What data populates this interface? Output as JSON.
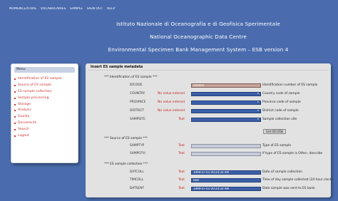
{
  "top_nav": {
    "items": [
      "NOMENCLATURE",
      "VOCABULARIES",
      "SAMPLE",
      "SIGN OUT",
      "HELP"
    ]
  },
  "header": {
    "line1": "Istituto Nazionale di Oceanografia e di Geofisica Sperimentale",
    "line2": "National Oceanographic Data Centre",
    "line3": "Environmental Specimen Bank Management System – ESB version 4"
  },
  "sidebar": {
    "heading": "Menu",
    "items": [
      "Identification of ES sample",
      "Source of ES sample",
      "ES sample collection",
      "Sample processing",
      "Storage",
      "Analysis",
      "Quality",
      "Documents",
      "Search",
      "Logout"
    ]
  },
  "panel": {
    "title": "Insert ES sample metadata",
    "sections": {
      "identification": "*** Identification of ES sample ***",
      "source": "*** Source of ES sample ***",
      "collection": "*** ES sample collection ***"
    },
    "fields": {
      "idcode": {
        "name": "IDCODE",
        "note": "",
        "value": "000005",
        "desc": "Identification number of ES sample"
      },
      "country": {
        "name": "COUNTRY",
        "note": "No value entered",
        "value": "",
        "desc": "Country code of sample"
      },
      "province": {
        "name": "PROVINCE",
        "note": "No value entered",
        "value": "",
        "desc": "Province code of sample"
      },
      "district": {
        "name": "DISTRICT",
        "note": "No value entered",
        "value": "",
        "desc": "District code of sample"
      },
      "samsite": {
        "name": "SAMPSITE",
        "note": "Text",
        "value": "",
        "desc": "Sample collection site"
      },
      "samptyp": {
        "name": "SAMPTYP",
        "note": "Text",
        "value": "",
        "desc": "Type of ES sample"
      },
      "sampoth": {
        "name": "SAMPOTH",
        "note": "Text",
        "value": "",
        "desc": "If type of ES sample is Other, describe"
      },
      "datcoll": {
        "name": "DATCOLL",
        "note": "Text",
        "value": "1999-07-01 00:24:30 AM",
        "desc": "Date of sample collection"
      },
      "timcoll": {
        "name": "TIMCOLL",
        "note": "Text",
        "value": "text",
        "desc": "Time of day sample collected (24 hour clock)"
      },
      "datsent": {
        "name": "DATSENT",
        "note": "Text",
        "value": "1999-07-01 00:24:30 AM",
        "desc": "Date sample was sent to ES bank"
      }
    },
    "get_button_label": "Get IDCODE"
  },
  "colors": {
    "background": "#4a6cae",
    "panel": "#e2e2e2",
    "field": "#3b5fa8",
    "note": "#cc2222"
  }
}
